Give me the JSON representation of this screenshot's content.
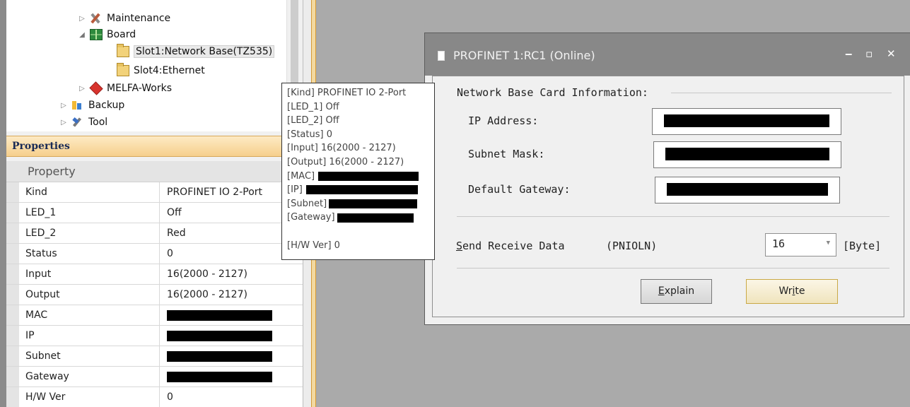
{
  "tree": {
    "items": [
      {
        "label": "Maintenance",
        "icon": "maintenance-icon",
        "expander": "▷"
      },
      {
        "label": "Board",
        "icon": "board-icon",
        "expander": "◢"
      },
      {
        "label": "Slot1:Network Base(TZ535)",
        "icon": "folder-icon",
        "selected": true
      },
      {
        "label": "Slot4:Ethernet",
        "icon": "folder-icon"
      },
      {
        "label": "MELFA-Works",
        "icon": "melfa-works-icon",
        "expander": "▷"
      },
      {
        "label": "Backup",
        "icon": "backup-icon",
        "expander": "▷"
      },
      {
        "label": "Tool",
        "icon": "tool-icon",
        "expander": "▷"
      }
    ]
  },
  "properties": {
    "title": "Properties",
    "pin_icon": "pin-icon",
    "group_label": "Property",
    "rows": [
      {
        "name": "Kind",
        "value": "PROFINET IO 2-Port"
      },
      {
        "name": "LED_1",
        "value": "Off"
      },
      {
        "name": "LED_2",
        "value": "Red"
      },
      {
        "name": "Status",
        "value": "0"
      },
      {
        "name": "Input",
        "value": "16(2000 - 2127)"
      },
      {
        "name": "Output",
        "value": "16(2000 - 2127)"
      },
      {
        "name": "MAC",
        "value": "",
        "redacted": true
      },
      {
        "name": "IP",
        "value": "",
        "redacted": true
      },
      {
        "name": "Subnet",
        "value": "",
        "redacted": true
      },
      {
        "name": "Gateway",
        "value": "",
        "redacted": true
      },
      {
        "name": "H/W Ver",
        "value": "0"
      }
    ]
  },
  "tooltip": {
    "lines": [
      {
        "text": "[Kind] PROFINET IO 2-Port"
      },
      {
        "text": "[LED_1] Off"
      },
      {
        "text": "[LED_2] Off"
      },
      {
        "text": "[Status] 0"
      },
      {
        "text": "[Input] 16(2000 - 2127)"
      },
      {
        "text": "[Output] 16(2000 - 2127)"
      },
      {
        "text": "[MAC]",
        "redacted": true
      },
      {
        "text": "[IP]",
        "redacted": true
      },
      {
        "text": "[Subnet]",
        "redacted": true
      },
      {
        "text": "[Gateway]",
        "redacted": true
      },
      {
        "text": ""
      },
      {
        "text": "[H/W Ver]  0"
      }
    ]
  },
  "dialog": {
    "title": "PROFINET 1:RC1 (Online)",
    "section_title": "Network Base Card Information:",
    "ip_label": "IP Address:",
    "subnet_label": "Subnet Mask:",
    "gateway_label": "Default Gateway:",
    "send_receive_label": "Send Receive Data",
    "send_receive_mnemonic": "S",
    "send_receive_rest": "end Receive Data",
    "param_label": "(PNIOLN)",
    "byte_value": "16",
    "byte_unit": "[Byte]",
    "explain_mnemonic": "E",
    "explain_rest": "xplain",
    "write_pre": "Wr",
    "write_mnemonic": "i",
    "write_post": "te",
    "minimize": "‒",
    "maximize": "▫",
    "close": "✕"
  }
}
